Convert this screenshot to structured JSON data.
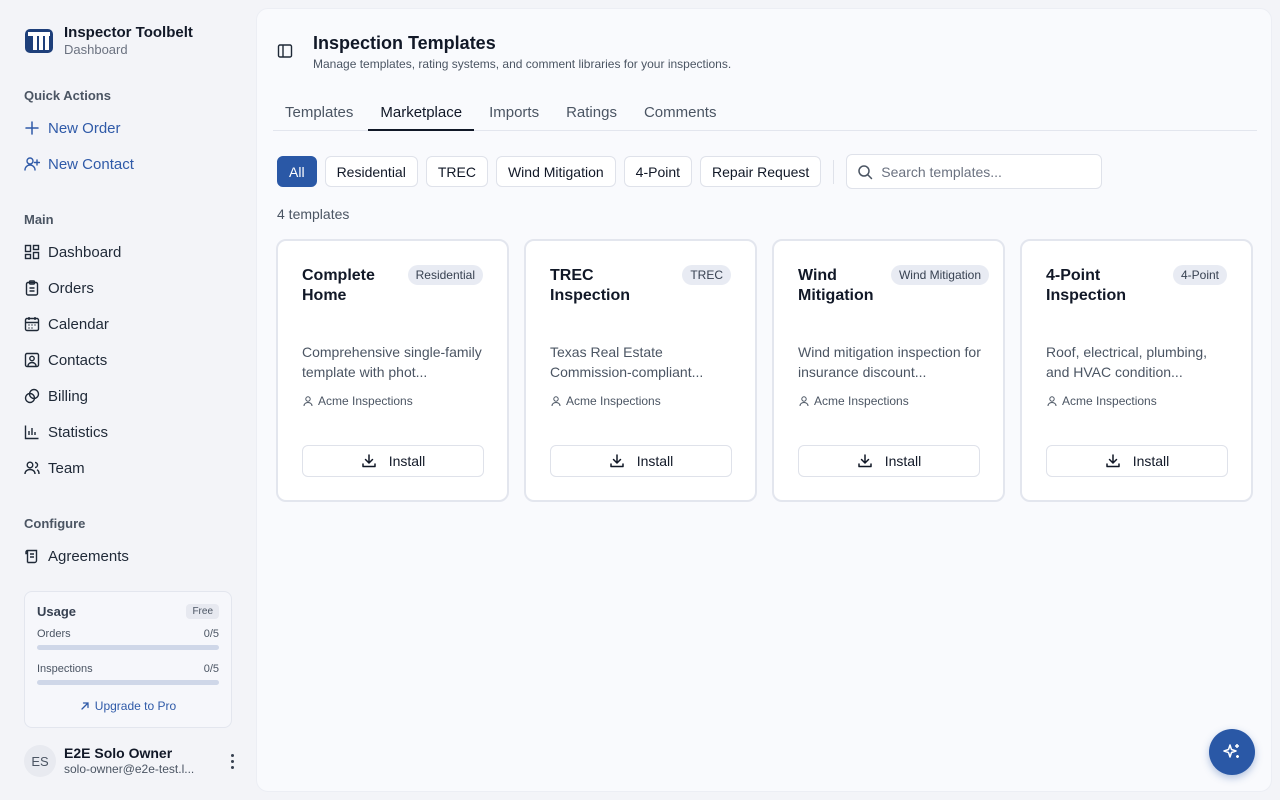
{
  "app": {
    "name": "Inspector Toolbelt",
    "subtitle": "Dashboard"
  },
  "sidebar": {
    "quick_actions_label": "Quick Actions",
    "quick_actions": [
      {
        "label": "New Order",
        "icon": "plus-icon"
      },
      {
        "label": "New Contact",
        "icon": "user-plus-icon"
      }
    ],
    "main_label": "Main",
    "main_items": [
      {
        "label": "Dashboard",
        "icon": "dashboard-icon"
      },
      {
        "label": "Orders",
        "icon": "clipboard-icon"
      },
      {
        "label": "Calendar",
        "icon": "calendar-icon"
      },
      {
        "label": "Contacts",
        "icon": "contacts-icon"
      },
      {
        "label": "Billing",
        "icon": "billing-icon"
      },
      {
        "label": "Statistics",
        "icon": "chart-icon"
      },
      {
        "label": "Team",
        "icon": "team-icon"
      }
    ],
    "configure_label": "Configure",
    "configure_items": [
      {
        "label": "Agreements",
        "icon": "scroll-icon"
      }
    ],
    "usage": {
      "title": "Usage",
      "plan": "Free",
      "rows": [
        {
          "label": "Orders",
          "value": "0/5",
          "fraction": 0
        },
        {
          "label": "Inspections",
          "value": "0/5",
          "fraction": 0
        }
      ],
      "upgrade_label": "Upgrade to Pro"
    },
    "user": {
      "initials": "ES",
      "name": "E2E Solo Owner",
      "email": "solo-owner@e2e-test.l..."
    }
  },
  "header": {
    "title": "Inspection Templates",
    "subtitle": "Manage templates, rating systems, and comment libraries for your inspections."
  },
  "tabs": [
    {
      "label": "Templates",
      "active": false
    },
    {
      "label": "Marketplace",
      "active": true
    },
    {
      "label": "Imports",
      "active": false
    },
    {
      "label": "Ratings",
      "active": false
    },
    {
      "label": "Comments",
      "active": false
    }
  ],
  "filters": [
    {
      "label": "All",
      "active": true
    },
    {
      "label": "Residential",
      "active": false
    },
    {
      "label": "TREC",
      "active": false
    },
    {
      "label": "Wind Mitigation",
      "active": false
    },
    {
      "label": "4-Point",
      "active": false
    },
    {
      "label": "Repair Request",
      "active": false
    }
  ],
  "search": {
    "placeholder": "Search templates...",
    "value": ""
  },
  "template_count": "4 templates",
  "cards": [
    {
      "title": "Complete Home",
      "badge": "Residential",
      "description": "Comprehensive single-family template with phot...",
      "author": "Acme Inspections",
      "button": "Install"
    },
    {
      "title": "TREC Inspection",
      "badge": "TREC",
      "description": "Texas Real Estate Commission-compliant...",
      "author": "Acme Inspections",
      "button": "Install"
    },
    {
      "title": "Wind Mitigation",
      "badge": "Wind Mitigation",
      "description": "Wind mitigation inspection for insurance discount...",
      "author": "Acme Inspections",
      "button": "Install"
    },
    {
      "title": "4-Point Inspection",
      "badge": "4-Point",
      "description": "Roof, electrical, plumbing, and HVAC condition...",
      "author": "Acme Inspections",
      "button": "Install"
    }
  ],
  "fab_icon": "sparkles-icon",
  "colors": {
    "accent": "#2a58a6",
    "link": "#2f5aa8",
    "background": "#f3f4f8"
  }
}
